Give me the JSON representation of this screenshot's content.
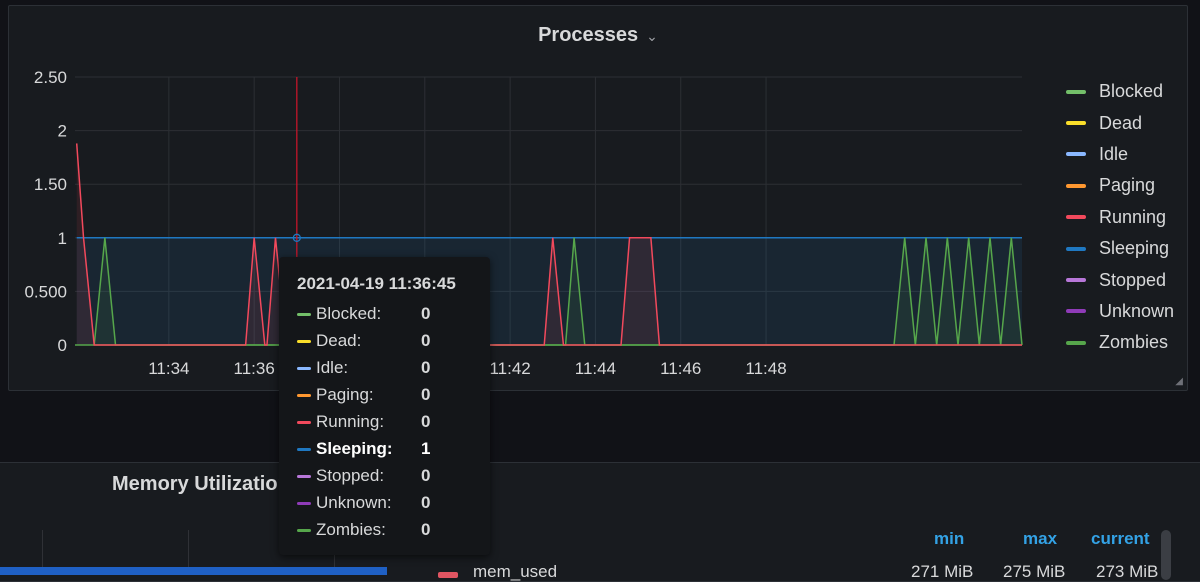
{
  "processes_panel": {
    "title": "Processes",
    "chevron": "⌄",
    "resize_glyph": "◢"
  },
  "chart_data": {
    "type": "line",
    "title": "Processes",
    "xlabel": "",
    "ylabel": "",
    "x_ticks": [
      "11:34",
      "11:36",
      "11:38",
      "11:40",
      "11:42",
      "11:44",
      "11:46",
      "11:48"
    ],
    "y_ticks": [
      "0",
      "0.500",
      "1",
      "1.50",
      "2",
      "2.50"
    ],
    "ylim": [
      0,
      2.5
    ],
    "xlim_minutes": [
      11.8,
      34.0
    ],
    "grid": true,
    "legend_position": "right",
    "series": [
      {
        "name": "Blocked",
        "color": "#73bf69",
        "values": []
      },
      {
        "name": "Dead",
        "color": "#fade2a",
        "values": []
      },
      {
        "name": "Idle",
        "color": "#8ab8ff",
        "values": []
      },
      {
        "name": "Paging",
        "color": "#ff9830",
        "values": []
      },
      {
        "name": "Running",
        "color": "#f2495c",
        "points": [
          [
            11.84,
            1.88
          ],
          [
            12.0,
            1
          ],
          [
            12.25,
            0
          ],
          [
            15.8,
            0
          ],
          [
            16.0,
            1
          ],
          [
            16.25,
            0
          ],
          [
            16.3,
            0
          ],
          [
            16.5,
            1
          ],
          [
            16.75,
            0
          ],
          [
            22.8,
            0
          ],
          [
            23.0,
            1
          ],
          [
            23.25,
            0
          ],
          [
            24.6,
            0
          ],
          [
            24.8,
            1
          ],
          [
            25.3,
            1
          ],
          [
            25.5,
            0
          ],
          [
            34.5,
            0
          ]
        ]
      },
      {
        "name": "Sleeping",
        "color": "#1f78c1",
        "points": [
          [
            11.84,
            1
          ],
          [
            34.0,
            1
          ]
        ]
      },
      {
        "name": "Stopped",
        "color": "#b877d9",
        "values": []
      },
      {
        "name": "Unknown",
        "color": "#8f3bb8",
        "values": []
      },
      {
        "name": "Zombies",
        "color": "#56a64b",
        "points": [
          [
            12.25,
            0
          ],
          [
            12.5,
            1
          ],
          [
            12.75,
            0
          ],
          [
            23.3,
            0
          ],
          [
            23.5,
            1
          ],
          [
            23.75,
            0
          ],
          [
            31.0,
            0
          ],
          [
            31.25,
            1
          ],
          [
            31.5,
            0
          ],
          [
            31.5,
            0
          ],
          [
            31.75,
            1
          ],
          [
            32.0,
            0
          ],
          [
            32.0,
            0
          ],
          [
            32.25,
            1
          ],
          [
            32.5,
            0
          ],
          [
            32.5,
            0
          ],
          [
            32.75,
            1
          ],
          [
            33.0,
            0
          ],
          [
            33.0,
            0
          ],
          [
            33.25,
            1
          ],
          [
            33.5,
            0
          ],
          [
            33.5,
            0
          ],
          [
            33.75,
            1
          ],
          [
            34.0,
            0
          ]
        ]
      }
    ],
    "hover_x_minute": 17.0,
    "hover_label": "2021-04-19 11:36:45"
  },
  "tooltip": {
    "time": "2021-04-19 11:36:45",
    "rows": [
      {
        "name": "Blocked:",
        "value": "0",
        "color": "#73bf69"
      },
      {
        "name": "Dead:",
        "value": "0",
        "color": "#fade2a"
      },
      {
        "name": "Idle:",
        "value": "0",
        "color": "#8ab8ff"
      },
      {
        "name": "Paging:",
        "value": "0",
        "color": "#ff9830"
      },
      {
        "name": "Running:",
        "value": "0",
        "color": "#f2495c"
      },
      {
        "name": "Sleeping:",
        "value": "1",
        "color": "#1f78c1",
        "highlight": true
      },
      {
        "name": "Stopped:",
        "value": "0",
        "color": "#b877d9"
      },
      {
        "name": "Unknown:",
        "value": "0",
        "color": "#8f3bb8"
      },
      {
        "name": "Zombies:",
        "value": "0",
        "color": "#56a64b"
      }
    ]
  },
  "memory_panel": {
    "title": "Memory Utilization",
    "headers": {
      "min": "min",
      "max": "max",
      "current": "current"
    },
    "row": {
      "name": "mem_used",
      "min": "271 MiB",
      "max": "275 MiB",
      "current": "273 MiB"
    },
    "swatch_color": "#e05562"
  }
}
